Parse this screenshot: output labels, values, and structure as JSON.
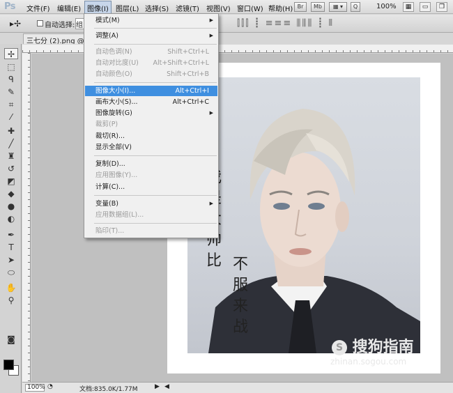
{
  "app": {
    "logo": "Ps"
  },
  "menubar": {
    "items": [
      "文件(F)",
      "编辑(E)",
      "图像(I)",
      "图层(L)",
      "选择(S)",
      "滤镜(T)",
      "视图(V)",
      "窗口(W)",
      "帮助(H)"
    ],
    "br": "Br",
    "mb": "Mb",
    "zoom": "100%"
  },
  "options": {
    "auto_select_label": "自动选择:",
    "select_value": "组"
  },
  "document": {
    "tab_title": "三七分 (2).png @ 1"
  },
  "image_menu": {
    "items": [
      {
        "label": "模式(M)",
        "shortcut": "",
        "submenu": true,
        "disabled": false
      },
      {
        "label": "调整(A)",
        "shortcut": "",
        "submenu": true,
        "disabled": false
      },
      {
        "label": "自动色调(N)",
        "shortcut": "Shift+Ctrl+L",
        "submenu": false,
        "disabled": true
      },
      {
        "label": "自动对比度(U)",
        "shortcut": "Alt+Shift+Ctrl+L",
        "submenu": false,
        "disabled": true
      },
      {
        "label": "自动颜色(O)",
        "shortcut": "Shift+Ctrl+B",
        "submenu": false,
        "disabled": true
      },
      {
        "label": "图像大小(I)...",
        "shortcut": "Alt+Ctrl+I",
        "submenu": false,
        "disabled": false,
        "highlighted": true
      },
      {
        "label": "画布大小(S)...",
        "shortcut": "Alt+Ctrl+C",
        "submenu": false,
        "disabled": false
      },
      {
        "label": "图像旋转(G)",
        "shortcut": "",
        "submenu": true,
        "disabled": false
      },
      {
        "label": "裁剪(P)",
        "shortcut": "",
        "submenu": false,
        "disabled": true
      },
      {
        "label": "裁切(R)...",
        "shortcut": "",
        "submenu": false,
        "disabled": false
      },
      {
        "label": "显示全部(V)",
        "shortcut": "",
        "submenu": false,
        "disabled": false
      },
      {
        "label": "复制(D)...",
        "shortcut": "",
        "submenu": false,
        "disabled": false
      },
      {
        "label": "应用图像(Y)...",
        "shortcut": "",
        "submenu": false,
        "disabled": true
      },
      {
        "label": "计算(C)...",
        "shortcut": "",
        "submenu": false,
        "disabled": false
      },
      {
        "label": "变量(B)",
        "shortcut": "",
        "submenu": true,
        "disabled": false
      },
      {
        "label": "应用数据组(L)...",
        "shortcut": "",
        "submenu": false,
        "disabled": true
      },
      {
        "label": "陷印(T)...",
        "shortcut": "",
        "submenu": false,
        "disabled": true
      }
    ]
  },
  "artwork": {
    "vertical_text_left": "我是大帅比",
    "vertical_text_right": "不服来战"
  },
  "watermark": {
    "brand": "搜狗指南",
    "url": "zhinan.sogou.com"
  },
  "statusbar": {
    "zoom": "100%",
    "doc_info": "文档:835.0K/1.77M"
  },
  "colors": {
    "menu_highlight": "#3f8fe0",
    "canvas_bg": "#c0c0c0",
    "panel_bg": "#d3d3d3"
  },
  "icons": [
    "move-tool-icon",
    "marquee-tool-icon",
    "lasso-tool-icon",
    "quick-select-tool-icon",
    "crop-tool-icon",
    "eyedropper-tool-icon",
    "healing-brush-icon",
    "brush-tool-icon",
    "clone-stamp-icon",
    "history-brush-icon",
    "eraser-tool-icon",
    "paint-bucket-icon",
    "blur-tool-icon",
    "dodge-tool-icon",
    "pen-tool-icon",
    "type-tool-icon",
    "path-select-icon",
    "shape-tool-icon",
    "hand-tool-icon",
    "zoom-tool-icon",
    "quick-mask-icon"
  ]
}
